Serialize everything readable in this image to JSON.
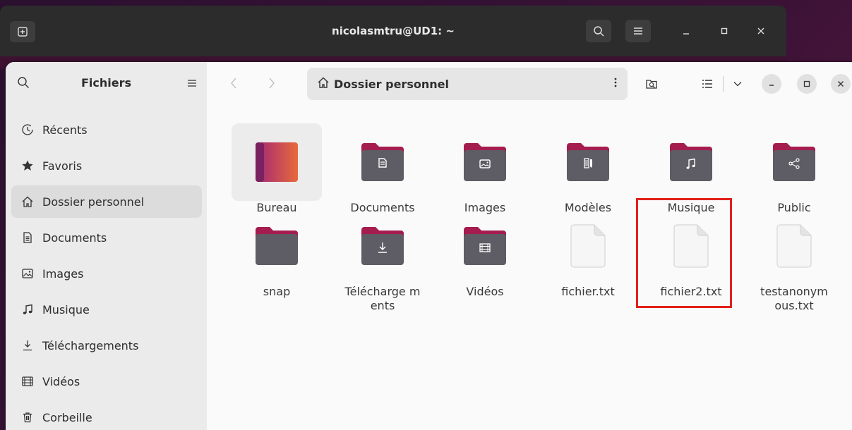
{
  "terminal": {
    "title": "nicolasmtru@UD1: ~"
  },
  "sidebar": {
    "title": "Fichiers",
    "items": [
      {
        "label": "Récents",
        "icon": "clock-icon"
      },
      {
        "label": "Favoris",
        "icon": "star-icon"
      },
      {
        "label": "Dossier personnel",
        "icon": "home-icon",
        "active": true
      },
      {
        "label": "Documents",
        "icon": "document-icon"
      },
      {
        "label": "Images",
        "icon": "image-icon"
      },
      {
        "label": "Musique",
        "icon": "music-icon"
      },
      {
        "label": "Téléchargements",
        "icon": "download-icon"
      },
      {
        "label": "Vidéos",
        "icon": "film-icon"
      },
      {
        "label": "Corbeille",
        "icon": "trash-icon"
      }
    ]
  },
  "toolbar": {
    "path": "Dossier personnel"
  },
  "files": [
    {
      "label": "Bureau",
      "kind": "desktop-folder"
    },
    {
      "label": "Documents",
      "kind": "folder",
      "emblem": "document-icon"
    },
    {
      "label": "Images",
      "kind": "folder",
      "emblem": "image-icon"
    },
    {
      "label": "Modèles",
      "kind": "folder",
      "emblem": "template-icon"
    },
    {
      "label": "Musique",
      "kind": "folder",
      "emblem": "music-icon"
    },
    {
      "label": "Public",
      "kind": "folder",
      "emblem": "share-icon"
    },
    {
      "label": "snap",
      "kind": "folder",
      "emblem": ""
    },
    {
      "label": "Télécharge ments",
      "kind": "folder",
      "emblem": "download-icon"
    },
    {
      "label": "Vidéos",
      "kind": "folder",
      "emblem": "film-icon"
    },
    {
      "label": "fichier.txt",
      "kind": "text-file"
    },
    {
      "label": "fichier2.txt",
      "kind": "text-file",
      "highlighted": true
    },
    {
      "label": "testanonym ous.txt",
      "kind": "text-file"
    }
  ],
  "colors": {
    "folder_body": "#5e5c64",
    "folder_tab": "#a51d4f",
    "highlight": "#e3201b",
    "bureau_left": "#8e2a6e",
    "bureau_right": "#e8693a"
  }
}
